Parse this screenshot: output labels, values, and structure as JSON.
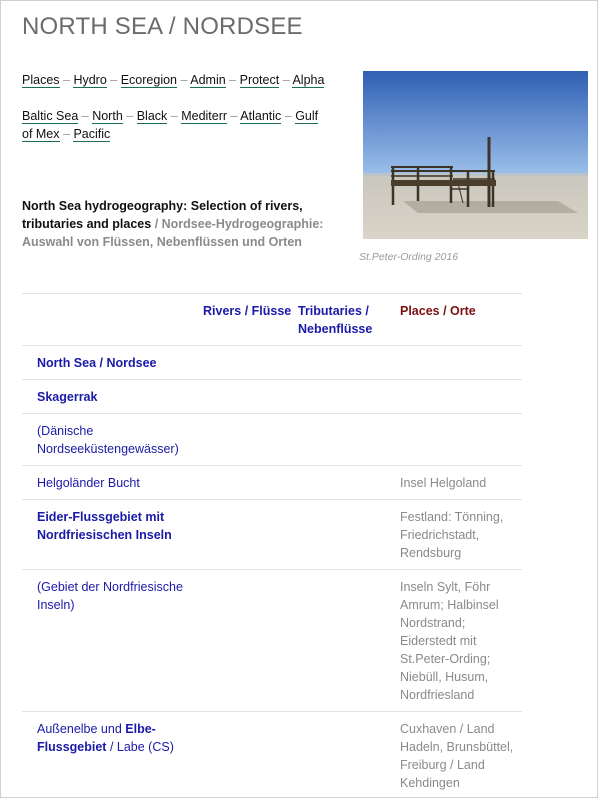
{
  "title": "NORTH SEA / NORDSEE",
  "nav1": [
    "Places",
    "Hydro",
    "Ecoregion",
    "Admin",
    "Protect",
    "Alpha"
  ],
  "nav2": [
    "Baltic Sea",
    "North",
    "Black",
    "Mediterr",
    "Atlantic",
    "Gulf of Mex",
    "Pacific"
  ],
  "separator": "–",
  "intro": {
    "en": "North Sea hydrogeography: Selection of rivers, tributaries and places",
    "slash": " / ",
    "de": "Nordsee-Hydrogeographie: Auswahl von Flüssen, Nebenflüssen und Orten"
  },
  "photo": {
    "caption": "St.Peter-Ording 2016"
  },
  "table": {
    "headers": {
      "rivers": "Rivers / Flüsse",
      "tributaries": "Tributaries / Nebenflüsse",
      "places": "Places / Orte"
    },
    "rows": {
      "r1": {
        "name": "North Sea / Nordsee"
      },
      "r2": {
        "name": "Skagerrak"
      },
      "r3": {
        "name": "(Dänische Nordseeküstengewässer)"
      },
      "r4": {
        "name": "Helgoländer Bucht",
        "places": "Insel Helgoland"
      },
      "r5": {
        "name": "Eider-Flussgebiet mit Nordfriesischen Inseln",
        "places": "Festland: Tönning, Friedrichstadt, Rendsburg"
      },
      "r6": {
        "name": "(Gebiet der Nordfriesische Inseln)",
        "places": "Inseln Sylt, Föhr Amrum; Halbinsel Nordstrand; Eiderstedt mit St.Peter-Ording; Niebüll, Husum, Nordfriesland"
      },
      "r7": {
        "name_a": "Außenelbe und ",
        "name_b": "Elbe-Flussgebiet",
        "name_c": " / Labe (CS)",
        "places": "Cuxhaven / Land Hadeln, Brunsbüttel, Freiburg / Land Kehdingen"
      }
    }
  }
}
